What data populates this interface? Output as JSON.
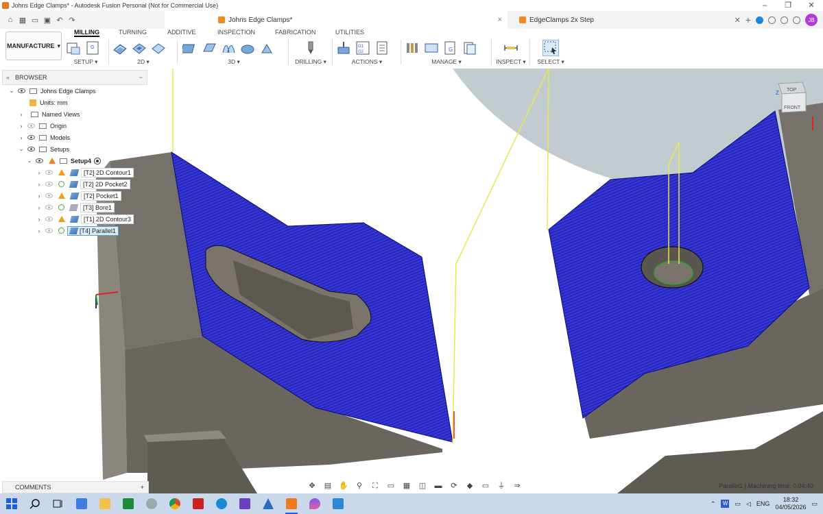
{
  "window": {
    "title": "Johns Edge Clamps* - Autodesk Fusion Personal (Not for Commercial Use)",
    "controls": [
      "–",
      "❐",
      "✕"
    ]
  },
  "tabs": {
    "active": "Johns Edge Clamps*",
    "other": "EdgeClamps 2x Step"
  },
  "ribbon": {
    "workspace": "MANUFACTURE",
    "tabs": [
      "MILLING",
      "TURNING",
      "ADDITIVE",
      "INSPECTION",
      "FABRICATION",
      "UTILITIES"
    ],
    "groups": [
      "SETUP ▾",
      "2D ▾",
      "3D ▾",
      "DRILLING ▾",
      "ACTIONS ▾",
      "MANAGE ▾",
      "INSPECT ▾",
      "SELECT ▾"
    ]
  },
  "browser": {
    "title": "BROWSER",
    "root": "Johns Edge Clamps",
    "units": "Units: mm",
    "folders": [
      "Named Views",
      "Origin",
      "Models",
      "Setups"
    ],
    "setup": "Setup4",
    "operations": [
      {
        "tool": "[T2]",
        "name": "2D Contour1",
        "status": "warning"
      },
      {
        "tool": "[T2]",
        "name": "2D Pocket2",
        "status": "ok"
      },
      {
        "tool": "[T2]",
        "name": "Pocket1",
        "status": "warning"
      },
      {
        "tool": "[T3]",
        "name": "Bore1",
        "status": "ok"
      },
      {
        "tool": "[T1]",
        "name": "2D Contour3",
        "status": "warning"
      },
      {
        "tool": "[T4]",
        "name": "Parallel1",
        "status": "ok",
        "selected": true
      }
    ]
  },
  "viewcube": {
    "top": "TOP",
    "front": "FRONT",
    "axis": "Z"
  },
  "comments": {
    "label": "COMMENTS"
  },
  "status": {
    "text": "Parallel1 | Machining time: 0:04:40"
  },
  "taskbar": {
    "lang": "ENG",
    "time": "18:32",
    "date": "04/05/2026"
  },
  "colors": {
    "toolpath": "#2020c8",
    "stock": "#6e6a63",
    "rapid": "#e8e84a",
    "accent": "#2a5dd9"
  }
}
